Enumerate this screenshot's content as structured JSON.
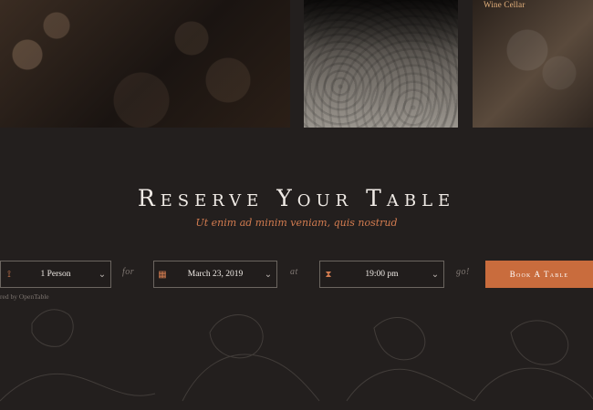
{
  "photos": {
    "right_photo_text": "Wine Cellar"
  },
  "hero": {
    "title": "Reserve Your Table",
    "subtitle": "Ut enim ad minim veniam, quis nostrud"
  },
  "reservation": {
    "person_value": "1 Person",
    "connector_for": "for",
    "date_value": "March 23, 2019",
    "connector_at": "at",
    "time_value": "19:00 pm",
    "connector_go": "go!",
    "book_label": "Book A Table",
    "powered_by": "red by OpenTable"
  },
  "icons": {
    "person": "person-icon",
    "calendar": "calendar-icon",
    "clock": "clock-icon",
    "chevron": "chevron-down-icon"
  },
  "colors": {
    "background": "#231f1e",
    "accent": "#c96c3d",
    "subtitle": "#d37c50",
    "border": "#6b6560"
  }
}
